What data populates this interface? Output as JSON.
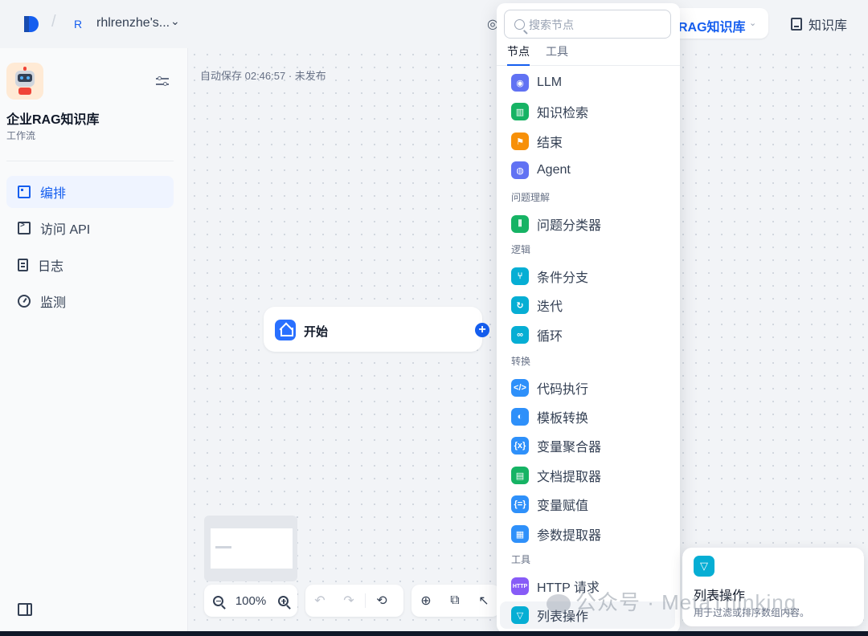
{
  "topbar": {
    "workspace_initial": "R",
    "workspace_name": "rhlrenzhe's...",
    "workspace_chevron": "chevron-down-icon",
    "app_selector_label": "RAG知识库",
    "knowledge_label": "知识库"
  },
  "sidebar": {
    "app_name": "企业RAG知识库",
    "app_type": "工作流",
    "items": [
      {
        "label": "编排",
        "icon": "workflow-board-icon",
        "active": true
      },
      {
        "label": "访问 API",
        "icon": "terminal-icon",
        "active": false
      },
      {
        "label": "日志",
        "icon": "log-doc-icon",
        "active": false
      },
      {
        "label": "监测",
        "icon": "gauge-icon",
        "active": false
      }
    ]
  },
  "canvas": {
    "autosave_text": "自动保存 02:46:57 · 未发布",
    "start_node_label": "开始",
    "zoom": "100%"
  },
  "panel": {
    "search_placeholder": "搜索节点",
    "tabs": [
      "节点",
      "工具"
    ],
    "active_tab": "节点",
    "items": [
      {
        "label": "LLM",
        "color": "#6172f3",
        "icon": "llm-icon"
      },
      {
        "label": "知识检索",
        "color": "#16b364",
        "icon": "knowledge-retrieval-icon"
      },
      {
        "label": "结束",
        "color": "#f79009",
        "icon": "end-flag-icon"
      },
      {
        "label": "Agent",
        "color": "#6172f3",
        "icon": "agent-icon"
      },
      {
        "label": "问题分类器",
        "color": "#16b364",
        "icon": "classifier-icon"
      },
      {
        "label": "条件分支",
        "color": "#06aed4",
        "icon": "branch-icon"
      },
      {
        "label": "迭代",
        "color": "#06aed4",
        "icon": "iteration-icon"
      },
      {
        "label": "循环",
        "color": "#06aed4",
        "icon": "loop-icon"
      },
      {
        "label": "代码执行",
        "color": "#2e90fa",
        "icon": "code-icon"
      },
      {
        "label": "模板转换",
        "color": "#2e90fa",
        "icon": "template-icon"
      },
      {
        "label": "变量聚合器",
        "color": "#2e90fa",
        "icon": "variable-aggregator-icon"
      },
      {
        "label": "文档提取器",
        "color": "#16b364",
        "icon": "doc-extractor-icon"
      },
      {
        "label": "变量赋值",
        "color": "#2e90fa",
        "icon": "variable-assign-icon"
      },
      {
        "label": "参数提取器",
        "color": "#2e90fa",
        "icon": "param-extractor-icon"
      },
      {
        "label": "HTTP 请求",
        "color": "#875bf7",
        "icon": "http-icon"
      },
      {
        "label": "列表操作",
        "color": "#06aed4",
        "icon": "list-filter-icon"
      }
    ],
    "sections": [
      "问题理解",
      "逻辑",
      "转换",
      "工具"
    ]
  },
  "tooltip": {
    "title": "列表操作",
    "description": "用于过滤或排序数组内容。"
  },
  "watermark": "公众号 · MetaThinking"
}
